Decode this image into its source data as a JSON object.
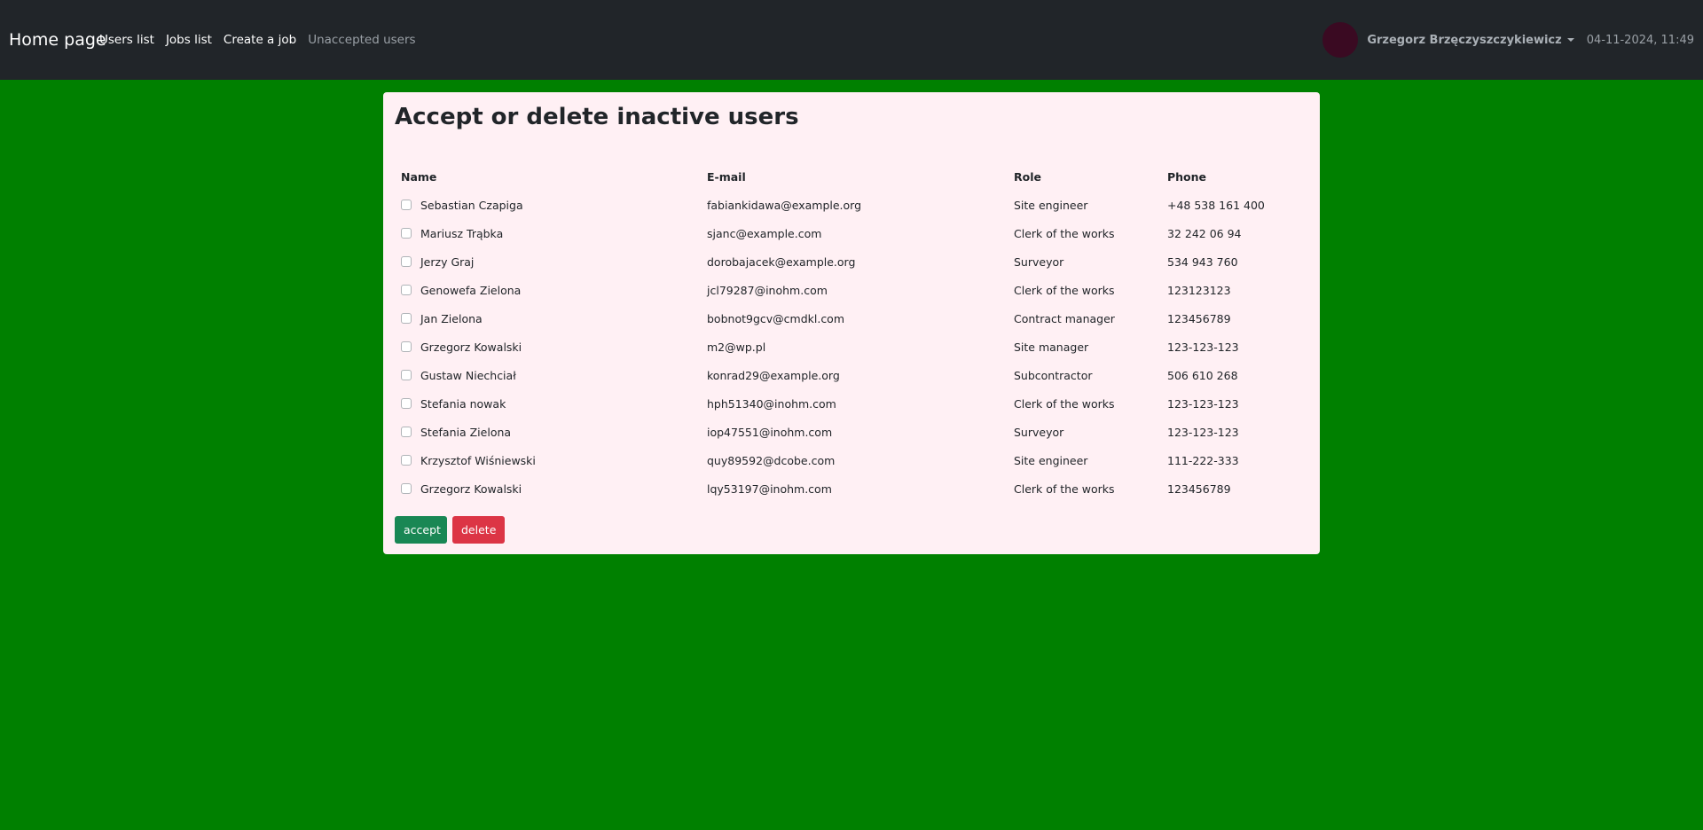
{
  "navbar": {
    "brand": "Home page",
    "links": [
      "Users list",
      "Jobs list",
      "Create a job",
      "Unaccepted users"
    ],
    "user_name": "Grzegorz Brzęczyszczykiewicz",
    "datetime": "04-11-2024, 11:49"
  },
  "main": {
    "title": "Accept or delete inactive users",
    "columns": [
      "Name",
      "E-mail",
      "Role",
      "Phone"
    ],
    "rows": [
      {
        "name": "Sebastian Czapiga",
        "email": "fabiankidawa@example.org",
        "role": "Site engineer",
        "phone": "+48 538 161 400"
      },
      {
        "name": "Mariusz Trąbka",
        "email": "sjanc@example.com",
        "role": "Clerk of the works",
        "phone": "32 242 06 94"
      },
      {
        "name": "Jerzy Graj",
        "email": "dorobajacek@example.org",
        "role": "Surveyor",
        "phone": "534 943 760"
      },
      {
        "name": "Genowefa Zielona",
        "email": "jcl79287@inohm.com",
        "role": "Clerk of the works",
        "phone": "123123123"
      },
      {
        "name": "Jan Zielona",
        "email": "bobnot9gcv@cmdkl.com",
        "role": "Contract manager",
        "phone": "123456789"
      },
      {
        "name": "Grzegorz Kowalski",
        "email": "m2@wp.pl",
        "role": "Site manager",
        "phone": "123-123-123"
      },
      {
        "name": "Gustaw Niechciał",
        "email": "konrad29@example.org",
        "role": "Subcontractor",
        "phone": "506 610 268"
      },
      {
        "name": "Stefania nowak",
        "email": "hph51340@inohm.com",
        "role": "Clerk of the works",
        "phone": "123-123-123"
      },
      {
        "name": "Stefania Zielona",
        "email": "iop47551@inohm.com",
        "role": "Surveyor",
        "phone": "123-123-123"
      },
      {
        "name": "Krzysztof Wiśniewski",
        "email": "quy89592@dcobe.com",
        "role": "Site engineer",
        "phone": "111-222-333"
      },
      {
        "name": "Grzegorz Kowalski",
        "email": "lqy53197@inohm.com",
        "role": "Clerk of the works",
        "phone": "123456789"
      }
    ],
    "accept_label": "accept",
    "delete_label": "delete"
  },
  "colors": {
    "page_background": "#008000",
    "navbar_background": "#212529",
    "card_background": "#fff0f4",
    "accept_button": "#198754",
    "delete_button": "#dc3545"
  }
}
